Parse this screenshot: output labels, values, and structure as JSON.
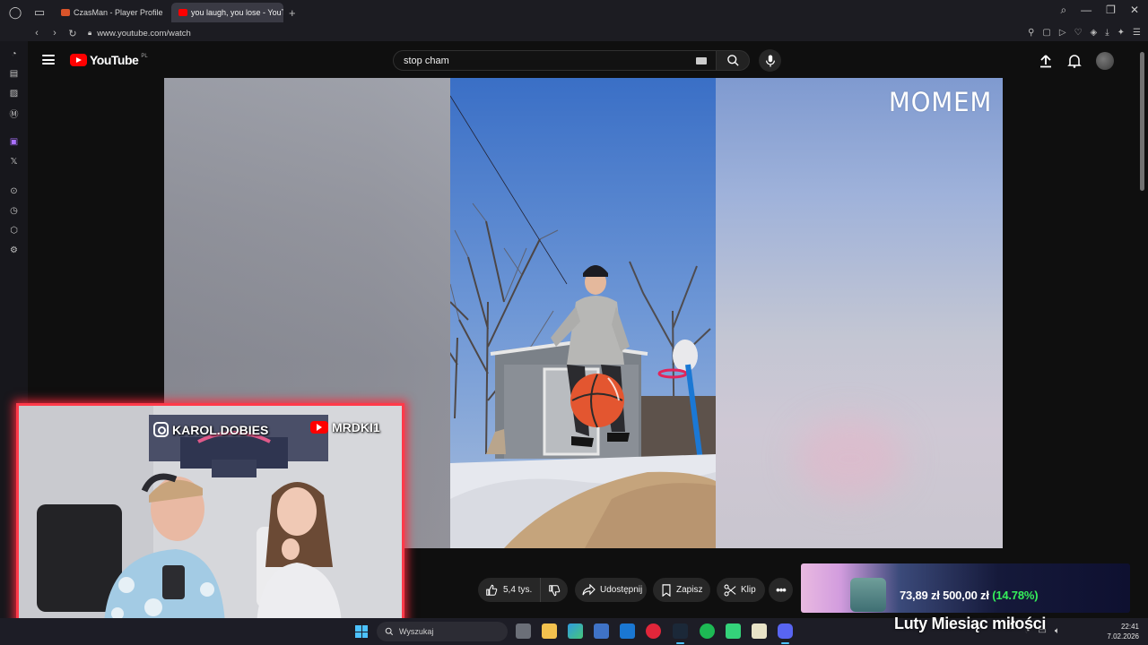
{
  "browser": {
    "tabs": [
      {
        "label": "CzasMan - Player Profile",
        "active": false
      },
      {
        "label": "you laugh, you lose - YouTube",
        "active": true
      }
    ],
    "new_tab": "+",
    "url": "www.youtube.com/watch"
  },
  "youtube": {
    "logo_text": "YouTube",
    "country_code": "PL",
    "search_query": "stop cham",
    "actions": {
      "likes": "5,4 tys.",
      "share": "Udostępnij",
      "save": "Zapisz",
      "clip": "Klip",
      "more": "•••"
    }
  },
  "video": {
    "watermark": "MOMEM"
  },
  "stream_overlay": {
    "instagram_handle": "KAROL.DOBIES",
    "youtube_handle": "MRDKI1",
    "goal_current": "73,89 zł",
    "goal_target": "500,00 zł",
    "goal_percent_text": "(14.78%)",
    "goal_progress": 0.1478,
    "goal_title": "Luty Miesiąc miłości"
  },
  "taskbar": {
    "search_placeholder": "Wyszukaj",
    "time": "22:41",
    "date": "7.02.2026"
  },
  "colors": {
    "yt_red": "#ff0000",
    "webcam_border": "#ff3a4a",
    "goal_percent": "#35f05a",
    "taskbar_accent": "#4cc2ff"
  }
}
